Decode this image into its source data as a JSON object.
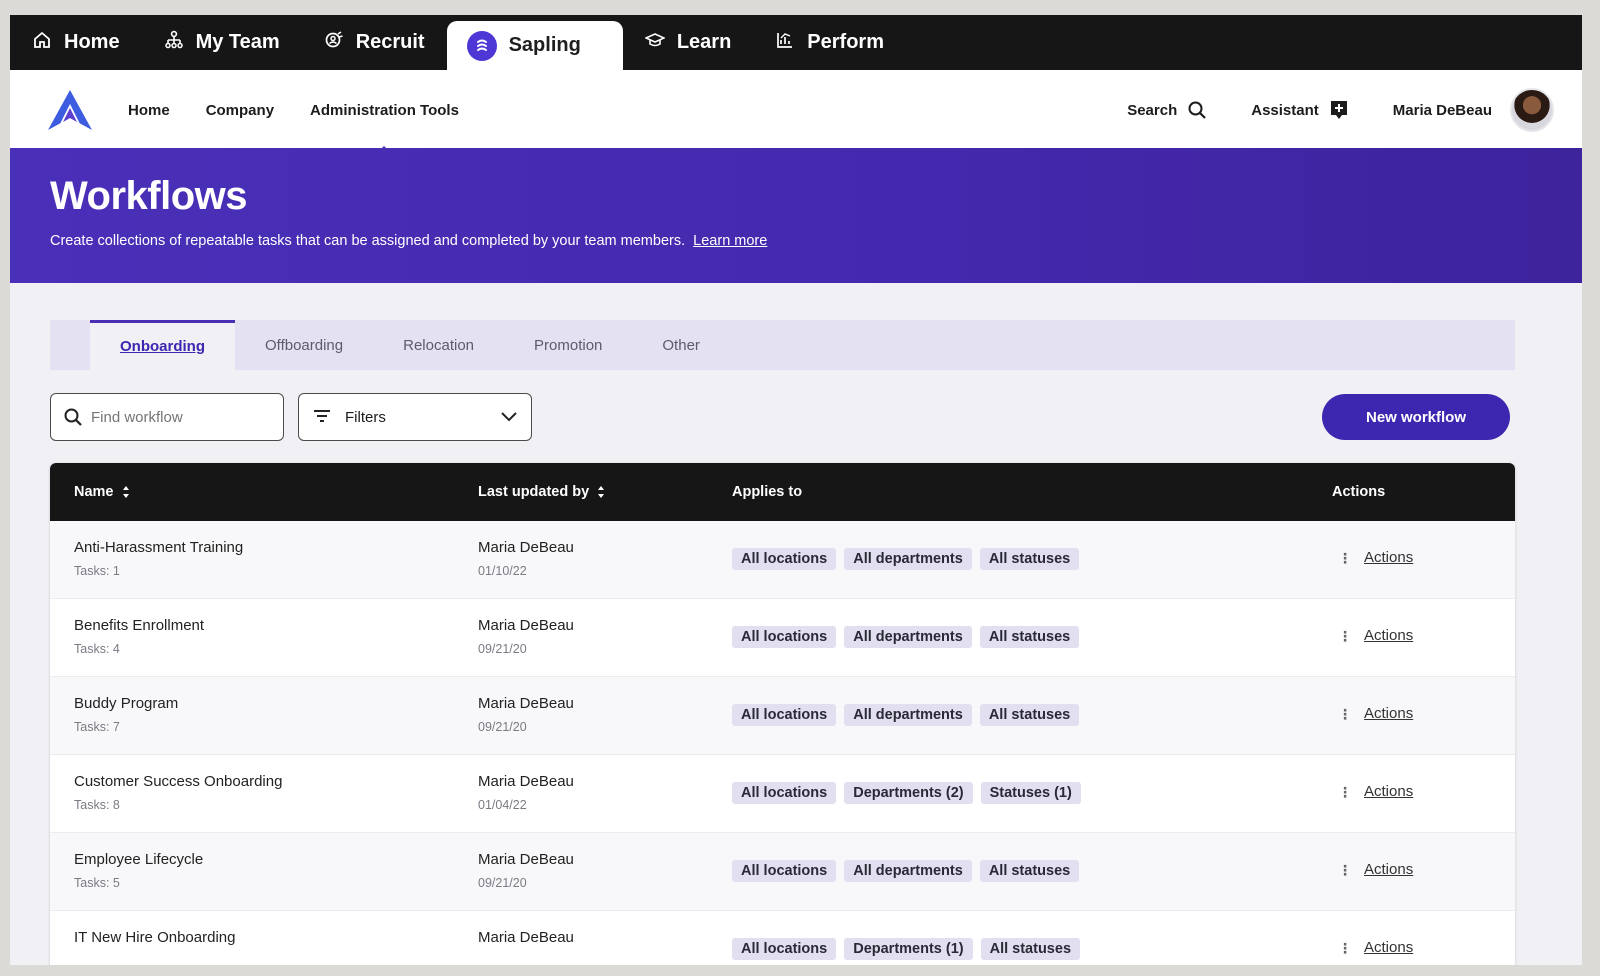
{
  "product_bar": {
    "tabs": [
      {
        "label": "Home",
        "icon": "home-icon"
      },
      {
        "label": "My Team",
        "icon": "org-chart-icon"
      },
      {
        "label": "Recruit",
        "icon": "recruit-icon"
      },
      {
        "label": "Sapling",
        "icon": "sapling-logo",
        "active": true
      },
      {
        "label": "Learn",
        "icon": "graduation-cap-icon"
      },
      {
        "label": "Perform",
        "icon": "chart-icon"
      }
    ]
  },
  "subnav": {
    "links": [
      "Home",
      "Company",
      "Administration Tools"
    ],
    "search_label": "Search",
    "assistant_label": "Assistant",
    "user_name": "Maria DeBeau"
  },
  "hero": {
    "title": "Workflows",
    "description": "Create collections of repeatable tasks that can be assigned and completed by your team members.",
    "learn_more": "Learn more"
  },
  "tabs": [
    "Onboarding",
    "Offboarding",
    "Relocation",
    "Promotion",
    "Other"
  ],
  "toolbar": {
    "search_placeholder": "Find workflow",
    "filters_label": "Filters",
    "new_button": "New workflow"
  },
  "table": {
    "columns": [
      "Name",
      "Last updated by",
      "Applies to",
      "Actions"
    ],
    "rows": [
      {
        "name": "Anti-Harassment Training",
        "tasks": "Tasks: 1",
        "updated_by": "Maria DeBeau",
        "date": "01/10/22",
        "chips": [
          "All locations",
          "All departments",
          "All statuses"
        ],
        "action": "Actions"
      },
      {
        "name": "Benefits Enrollment",
        "tasks": "Tasks: 4",
        "updated_by": "Maria DeBeau",
        "date": "09/21/20",
        "chips": [
          "All locations",
          "All departments",
          "All statuses"
        ],
        "action": "Actions"
      },
      {
        "name": "Buddy Program",
        "tasks": "Tasks: 7",
        "updated_by": "Maria DeBeau",
        "date": "09/21/20",
        "chips": [
          "All locations",
          "All departments",
          "All statuses"
        ],
        "action": "Actions"
      },
      {
        "name": "Customer Success Onboarding",
        "tasks": "Tasks: 8",
        "updated_by": "Maria DeBeau",
        "date": "01/04/22",
        "chips": [
          "All locations",
          "Departments (2)",
          "Statuses (1)"
        ],
        "action": "Actions"
      },
      {
        "name": "Employee Lifecycle",
        "tasks": "Tasks: 5",
        "updated_by": "Maria DeBeau",
        "date": "09/21/20",
        "chips": [
          "All locations",
          "All departments",
          "All statuses"
        ],
        "action": "Actions"
      },
      {
        "name": "IT New Hire Onboarding",
        "tasks": "",
        "updated_by": "Maria DeBeau",
        "date": "",
        "chips": [
          "All locations",
          "Departments (1)",
          "All statuses"
        ],
        "action": "Actions"
      }
    ]
  },
  "colors": {
    "brand": "#4a2fb6",
    "dark": "#161616",
    "chip": "#e2e0f0"
  }
}
